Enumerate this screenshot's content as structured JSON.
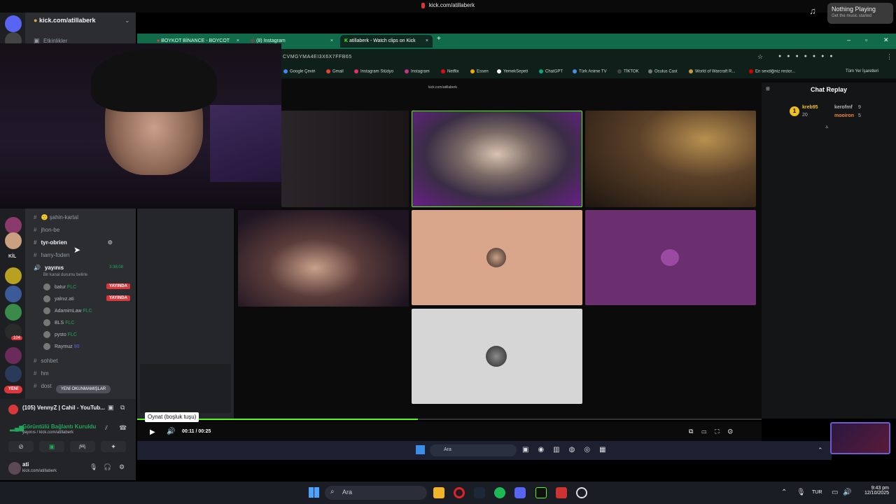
{
  "top": {
    "title": "kick.com/atillaberk"
  },
  "now_playing": {
    "title": "Nothing Playing",
    "subtitle": "Get the music started"
  },
  "discord": {
    "server_name": "kick.com/atillaberk",
    "events_label": "Etkinlikler",
    "channels": [
      {
        "name": "🙂 şahin-kartal"
      },
      {
        "name": "jhon-be"
      },
      {
        "name": "tyr-obrien"
      },
      {
        "name": "harry-foden"
      }
    ],
    "voice_channel": {
      "name": "yayınıs",
      "timer": "3:38:08",
      "status": "Bir kanal durumu belirle"
    },
    "voice_users": [
      {
        "name": "batur",
        "tag": "FLC",
        "live": "YAYINDA"
      },
      {
        "name": "yalnız.ati",
        "tag": "",
        "live": "YAYINDA"
      },
      {
        "name": "AdamimLaw",
        "tag": "FLC",
        "live": ""
      },
      {
        "name": "BLS",
        "tag": "FLC",
        "live": ""
      },
      {
        "name": "pysto",
        "tag": "FLC",
        "live": ""
      },
      {
        "name": "Raymuz",
        "tag": "90",
        "live": ""
      }
    ],
    "channels_bottom": [
      {
        "name": "sohbet"
      },
      {
        "name": "hm"
      },
      {
        "name": "dost"
      }
    ],
    "new_unread": "YENİ OKUNMAMIŞLAR",
    "server_badge_new": "YENİ",
    "server_label_kil": "KİL",
    "badge_104": "104",
    "activity_title": "(105) VennyZ | Cahil - YouTub...",
    "connection": "Görüntülü Bağlantı Kuruldu",
    "connection_sub": "yayınıs / kick.com/atillaberk",
    "user": {
      "name": "ati",
      "status": "kick.com/atillaberk"
    }
  },
  "browser": {
    "tabs": [
      {
        "label": "BOYKOT BİNANCE - BOYCOT"
      },
      {
        "label": "(8) Instagram"
      },
      {
        "label": "atillaberk - Watch clips on Kick"
      }
    ],
    "url": "CVMGYMA4EI3X6X7FFB65",
    "bookmarks": [
      {
        "label": "Google Çeviri",
        "color": "#4285f4"
      },
      {
        "label": "Gmail",
        "color": "#ea4335"
      },
      {
        "label": "Instagram Stüdyo",
        "color": "#e1306c"
      },
      {
        "label": "Instagram",
        "color": "#c13584"
      },
      {
        "label": "Netflix",
        "color": "#e50914"
      },
      {
        "label": "Essen",
        "color": "#f7a600"
      },
      {
        "label": "YemekSepeti",
        "color": "#fff"
      },
      {
        "label": "ChatGPT",
        "color": "#10a37f"
      },
      {
        "label": "Türk Anime TV",
        "color": "#4a90e2"
      },
      {
        "label": "TİKTOK",
        "color": "#111"
      },
      {
        "label": "Oculus Cast",
        "color": "#777"
      },
      {
        "label": "World of Warcraft R...",
        "color": "#c69c3a"
      },
      {
        "label": "En sevdiğiniz restor...",
        "color": "#d40000"
      }
    ],
    "all_bookmarks": "Tüm Yer İşaretleri",
    "inner_url": "kick.com/atillaberk"
  },
  "chat": {
    "title": "Chat Replay",
    "users": [
      {
        "name": "kreb95",
        "color": "#f0c020",
        "count": "20"
      },
      {
        "name": "kerofmf",
        "color": "#b5b5b5",
        "count": "9"
      },
      {
        "name": "mooiron",
        "color": "#f08a3c",
        "count": "5"
      }
    ]
  },
  "player": {
    "tooltip": "Oynat (boşluk tuşu)",
    "time": "00:11 / 00:25",
    "progress": 0.45
  },
  "taskbar": {
    "search": "Ara",
    "inner_search": "Ara",
    "lang": "TUR",
    "time": "9:43 pm",
    "date": "12/10/2025"
  }
}
